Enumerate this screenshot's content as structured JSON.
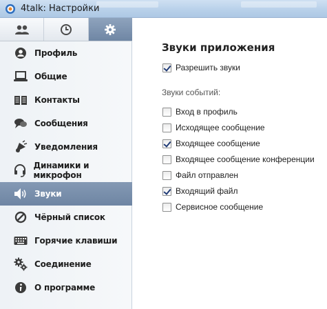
{
  "window": {
    "title": "4talk: Настройки"
  },
  "tabs": [
    {
      "icon": "contacts-icon",
      "active": false
    },
    {
      "icon": "clock-icon",
      "active": false
    },
    {
      "icon": "gear-icon",
      "active": true
    }
  ],
  "sidebar": {
    "items": [
      {
        "label": "Профиль",
        "icon": "profile-icon",
        "active": false
      },
      {
        "label": "Общие",
        "icon": "laptop-icon",
        "active": false
      },
      {
        "label": "Контакты",
        "icon": "book-icon",
        "active": false
      },
      {
        "label": "Сообщения",
        "icon": "chat-bubbles-icon",
        "active": false
      },
      {
        "label": "Уведомления",
        "icon": "notification-icon",
        "active": false
      },
      {
        "label": "Динамики и микрофон",
        "icon": "headset-icon",
        "active": false
      },
      {
        "label": "Звуки",
        "icon": "speaker-icon",
        "active": true
      },
      {
        "label": "Чёрный список",
        "icon": "block-icon",
        "active": false
      },
      {
        "label": "Горячие клавиши",
        "icon": "keyboard-icon",
        "active": false
      },
      {
        "label": "Соединение",
        "icon": "gears-icon",
        "active": false
      },
      {
        "label": "О программе",
        "icon": "info-icon",
        "active": false
      }
    ]
  },
  "main": {
    "title": "Звуки приложения",
    "enable_sounds": {
      "label": "Разрешить звуки",
      "checked": true
    },
    "events_heading": "Звуки событий:",
    "events": [
      {
        "label": "Вход в профиль",
        "checked": false
      },
      {
        "label": "Исходящее сообщение",
        "checked": false
      },
      {
        "label": "Входящее сообщение",
        "checked": true
      },
      {
        "label": "Входящее сообщение конференции",
        "checked": false
      },
      {
        "label": "Файл отправлен",
        "checked": false
      },
      {
        "label": "Входящий файл",
        "checked": true
      },
      {
        "label": "Сервисное сообщение",
        "checked": false
      }
    ]
  },
  "colors": {
    "active_item": "#7a90ad",
    "checkmark": "#1f3a75"
  }
}
